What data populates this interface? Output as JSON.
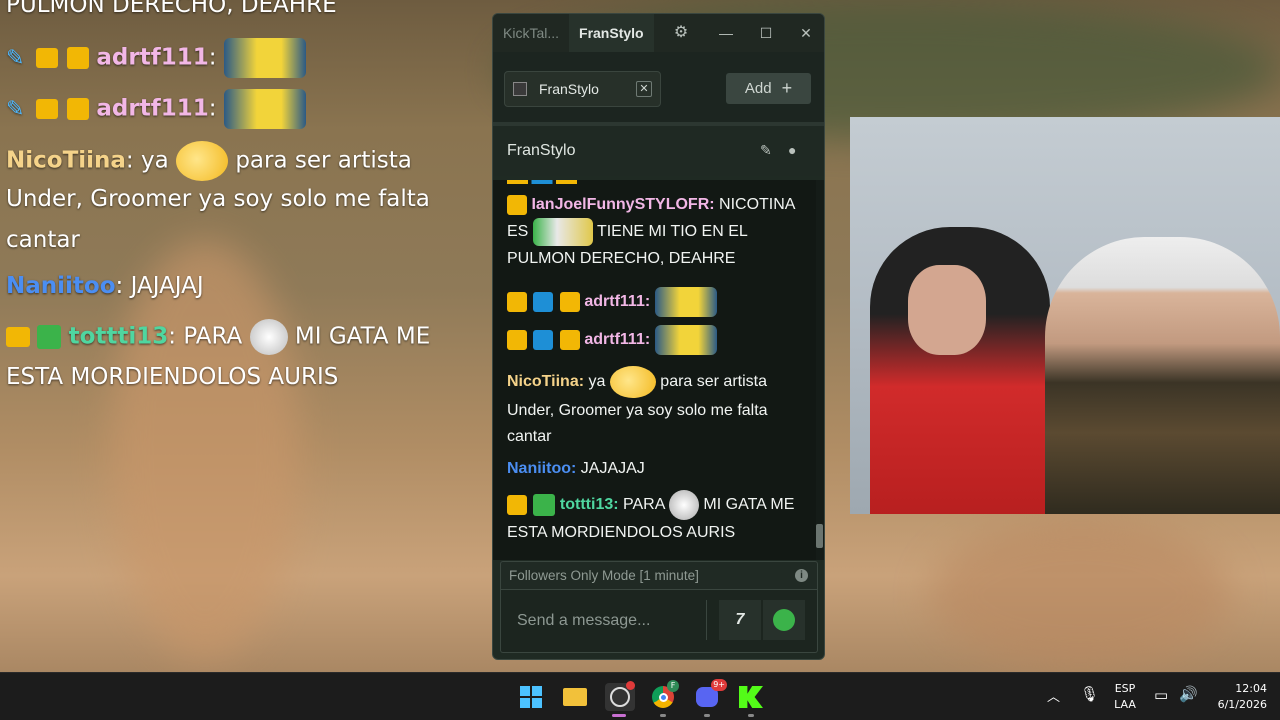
{
  "overlay": {
    "lines": [
      {
        "text": "PULMON DERECHO, DEAHRE"
      },
      {
        "user": "adrtf111",
        "sep": ":"
      },
      {
        "user": "adrtf111",
        "sep": ":"
      },
      {
        "user": "NicoTiina",
        "sep": ":",
        "pre": " ya",
        "post": " para ser artista"
      },
      {
        "text": "Under, Groomer ya soy solo me falta"
      },
      {
        "text": "cantar"
      },
      {
        "user": "Naniitoo",
        "sep": ":",
        "post": " JAJAJAJ"
      },
      {
        "user": "tottti13",
        "sep": ":",
        "pre": " PARA",
        "post": " MI GATA ME"
      },
      {
        "text": "ESTA MORDIENDOLOS AURIS"
      }
    ]
  },
  "window": {
    "tab_inactive": "KickTal...",
    "tab_active": "FranStylo",
    "settings_icon": "gear-icon",
    "minimize": "—",
    "maximize": "☐",
    "close": "✕",
    "channel_chip": "FranStylo",
    "add_label": "Add",
    "add_icon": "+",
    "channel_header": "FranStylo",
    "messages": [
      {
        "user": "IanJoelFunnySTYLOFR",
        "color": "#f2b7e6",
        "text_a": " NICOTINA",
        "text_b": "ES",
        "text_c": " TIENE MI TIO EN EL",
        "text_d": "PULMON DERECHO, DEAHRE"
      },
      {
        "user": "adrtf111",
        "color": "#f2b7e6"
      },
      {
        "user": "adrtf111",
        "color": "#f2b7e6"
      },
      {
        "user": "NicoTiina",
        "color": "#f5d38a",
        "text_a": " ya",
        "text_b": " para ser artista",
        "text_c": "Under, Groomer ya soy solo me falta",
        "text_d": "cantar"
      },
      {
        "user": "Naniitoo",
        "color": "#4b8ef2",
        "text_a": " JAJAJAJ"
      },
      {
        "user": "tottti13",
        "color": "#4fd6a0",
        "text_a": " PARA",
        "text_b": " MI GATA ME",
        "text_c": "ESTA MORDIENDOLOS AURIS"
      }
    ],
    "followers_mode": "Followers Only Mode [1 minute]",
    "message_placeholder": "Send a message..."
  },
  "taskbar": {
    "lang": "ESP",
    "layout": "LAA",
    "time": "12:04",
    "date": "6/1/2026",
    "discord_badge": "9+",
    "chrome_badge": "F"
  },
  "colors": {
    "accent": "#53fc18",
    "sub_badge": "#f2b705"
  }
}
